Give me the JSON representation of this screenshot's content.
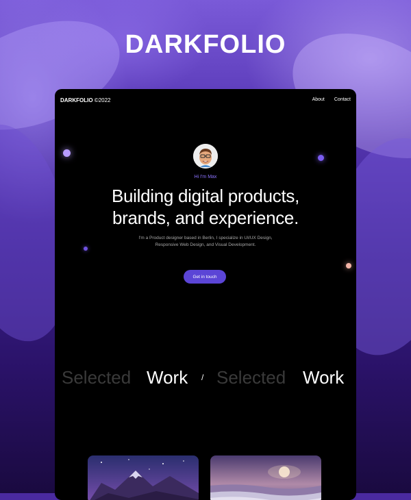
{
  "brand": {
    "title": "DARKFOLIO"
  },
  "nav": {
    "logo": "DARKFOLIO",
    "year": "©2022",
    "links": [
      "About",
      "Contact"
    ]
  },
  "hero": {
    "greeting": "Hi I'm Max",
    "headline_line1": "Building digital products,",
    "headline_line2": "brands, and experience.",
    "sub_line1": "I'm a Product designer based in Berlin, I specialize in UI/UX Design,",
    "sub_line2": "Responsive Web Design, and Visual Development.",
    "cta": "Get in touch"
  },
  "section": {
    "marquee": [
      {
        "text": "Selected",
        "style": "faded"
      },
      {
        "text": "Work",
        "style": "solid"
      },
      {
        "text": "/",
        "style": "slash"
      },
      {
        "text": "Selected",
        "style": "faded"
      },
      {
        "text": "Work",
        "style": "solid"
      }
    ]
  },
  "work_cards": [
    {
      "icon": "mountain-galaxy-image"
    },
    {
      "icon": "ocean-sunset-image"
    }
  ],
  "colors": {
    "accent": "#5b45d6",
    "greeting": "#8c73ff",
    "frame_bg": "#000000",
    "background": "#4a2aa0"
  }
}
